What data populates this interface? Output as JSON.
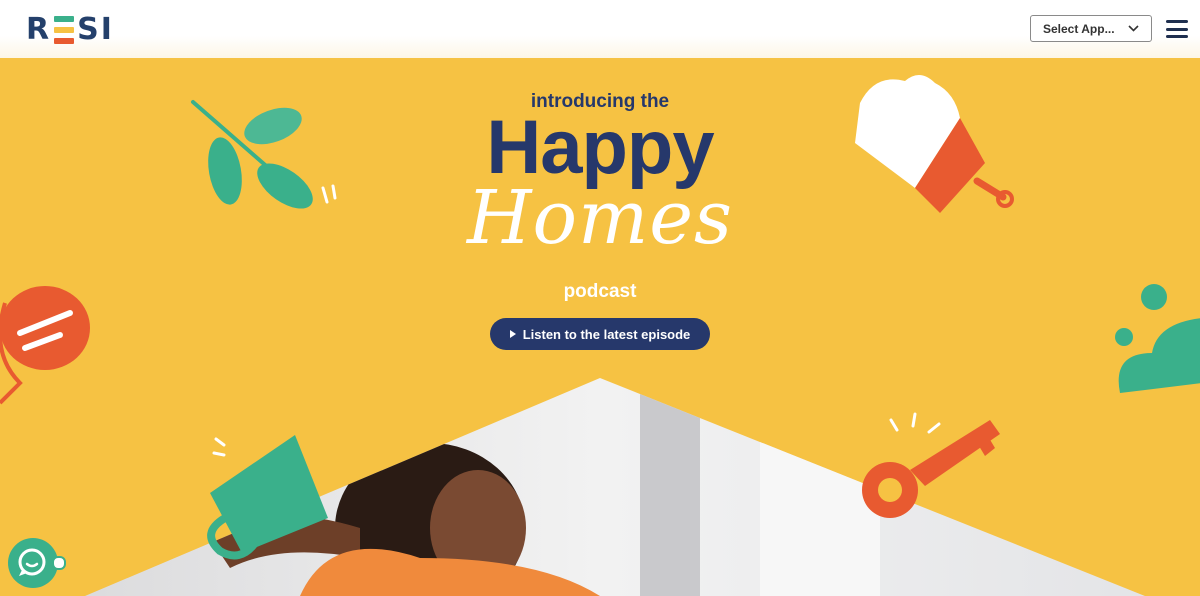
{
  "header": {
    "logo": {
      "text_r": "R",
      "text_si": "SI",
      "aria": "RESI",
      "e_colors": [
        "#3ab08b",
        "#f6c243",
        "#e85a30"
      ]
    },
    "select_app": {
      "label": "Select App...",
      "icon": "chevron-down-icon"
    },
    "menu_icon": "hamburger-menu-icon"
  },
  "hero": {
    "intro": "introducing the",
    "title_line1": "Happy",
    "title_line2": "Homes",
    "subtitle": "podcast",
    "cta_label": "Listen to the latest episode",
    "colors": {
      "background": "#f6c243",
      "navy": "#26386b",
      "teal": "#3ab08b",
      "orange": "#e85a30",
      "white": "#ffffff"
    }
  },
  "chat_widget": {
    "icon": "chat-bubble-icon"
  }
}
